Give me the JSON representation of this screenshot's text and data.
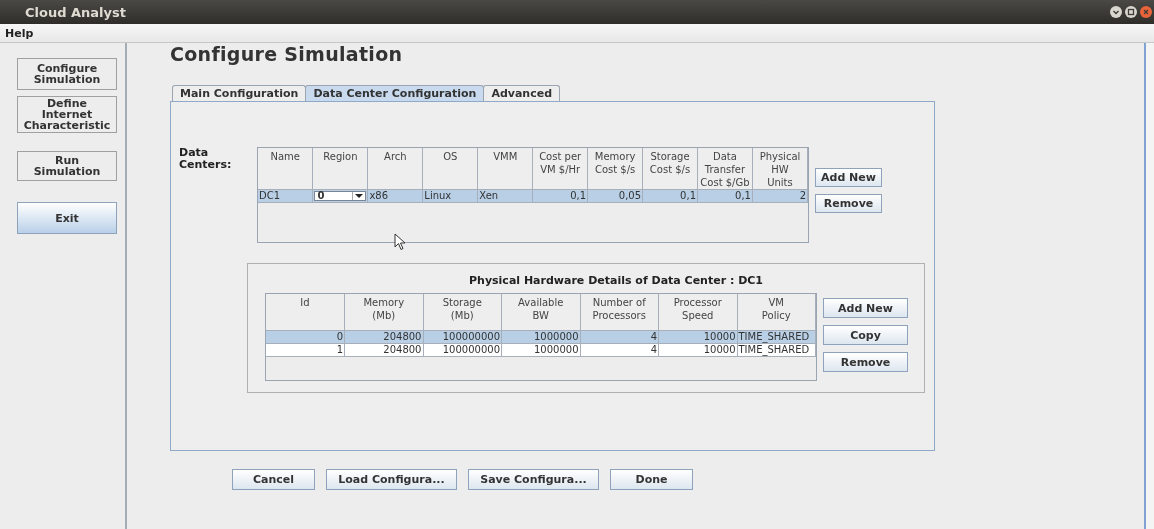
{
  "window": {
    "title": "Cloud Analyst"
  },
  "menu": [
    {
      "label": "Help"
    }
  ],
  "sidebar": {
    "buttons": [
      {
        "lines": [
          "Configure",
          "Simulation"
        ],
        "default": false
      },
      {
        "lines": [
          "Define",
          "Internet",
          "Characteristic"
        ],
        "default": false
      },
      {
        "lines": [
          "Run",
          "Simulation"
        ],
        "default": false
      },
      {
        "lines": [
          "Exit"
        ],
        "default": true
      }
    ]
  },
  "page_title": "Configure Simulation",
  "tabs": [
    {
      "label": "Main Configuration",
      "selected": false
    },
    {
      "label": "Data Center Configuration",
      "selected": true
    },
    {
      "label": "Advanced",
      "selected": false
    }
  ],
  "data_centers": {
    "label": "Data Centers:",
    "columns": [
      {
        "lines": [
          "Name"
        ],
        "kind": "text"
      },
      {
        "lines": [
          "Region"
        ],
        "kind": "combo"
      },
      {
        "lines": [
          "Arch"
        ],
        "kind": "text"
      },
      {
        "lines": [
          "OS"
        ],
        "kind": "text"
      },
      {
        "lines": [
          "VMM"
        ],
        "kind": "text"
      },
      {
        "lines": [
          "Cost per",
          "VM $/Hr"
        ],
        "kind": "number"
      },
      {
        "lines": [
          "Memory",
          "Cost $/s"
        ],
        "kind": "number"
      },
      {
        "lines": [
          "Storage",
          "Cost $/s"
        ],
        "kind": "number"
      },
      {
        "lines": [
          "Data",
          "Transfer",
          "Cost $/Gb"
        ],
        "kind": "number"
      },
      {
        "lines": [
          "Physical",
          "HW",
          "Units"
        ],
        "kind": "number"
      }
    ],
    "rows": [
      {
        "selected": true,
        "cells": [
          "DC1",
          "0",
          "x86",
          "Linux",
          "Xen",
          "0,1",
          "0,05",
          "0,1",
          "0,1",
          "2"
        ]
      }
    ],
    "buttons": [
      "Add New",
      "Remove"
    ]
  },
  "hardware": {
    "title": "Physical Hardware Details of Data Center : DC1",
    "columns": [
      {
        "lines": [
          "Id"
        ],
        "kind": "number"
      },
      {
        "lines": [
          "Memory",
          "(Mb)"
        ],
        "kind": "number"
      },
      {
        "lines": [
          "Storage",
          "(Mb)"
        ],
        "kind": "number"
      },
      {
        "lines": [
          "Available",
          "BW"
        ],
        "kind": "number"
      },
      {
        "lines": [
          "Number of",
          "Processors"
        ],
        "kind": "number"
      },
      {
        "lines": [
          "Processor",
          "Speed"
        ],
        "kind": "number"
      },
      {
        "lines": [
          "VM",
          "Policy"
        ],
        "kind": "text"
      }
    ],
    "rows": [
      {
        "selected": true,
        "cells": [
          "0",
          "204800",
          "100000000",
          "1000000",
          "4",
          "10000",
          "TIME_SHARED"
        ]
      },
      {
        "selected": false,
        "cells": [
          "1",
          "204800",
          "100000000",
          "1000000",
          "4",
          "10000",
          "TIME_SHARED"
        ]
      }
    ],
    "buttons": [
      "Add New",
      "Copy",
      "Remove"
    ]
  },
  "footer_buttons": [
    "Cancel",
    "Load Configura...",
    "Save Configura...",
    "Done"
  ]
}
